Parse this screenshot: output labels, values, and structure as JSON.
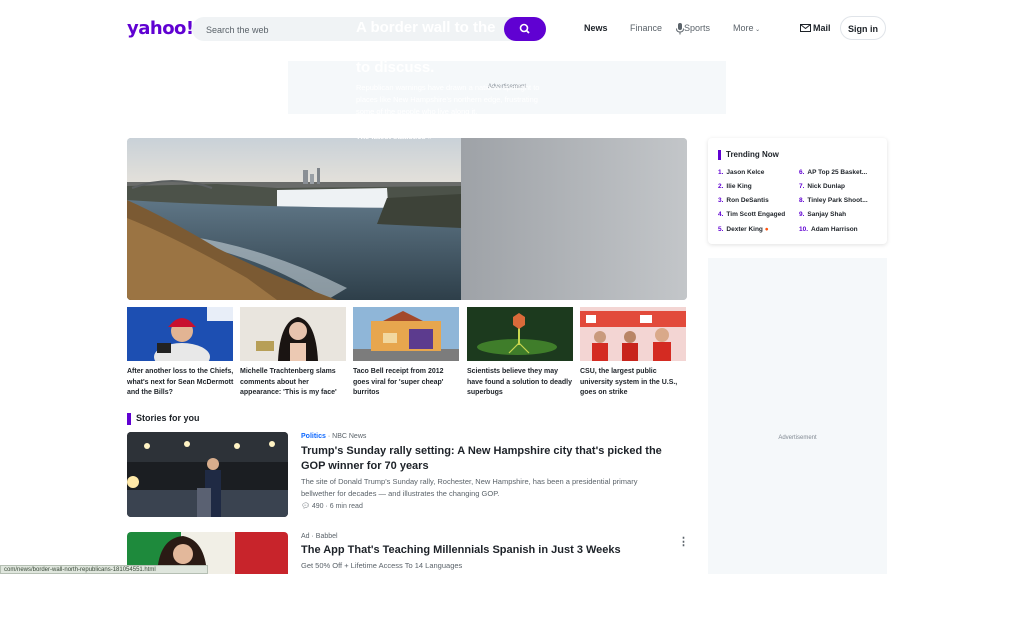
{
  "header": {
    "logo": "yahoo!",
    "search_placeholder": "Search the web",
    "nav": [
      "News",
      "Finance",
      "Sports",
      "More"
    ],
    "mail_label": "Mail",
    "signin_label": "Sign in"
  },
  "ads": {
    "top": "Advertisement",
    "right": "Advertisement"
  },
  "hero": {
    "title": "A border wall to the north? Republicans want to discuss.",
    "description": "Republican warnings have drawn a national spotlight to places like New Hampshire's northern edge, frustrating some of the people who live along it.",
    "link": "The latest statistics »"
  },
  "thumbs": [
    {
      "caption": "After another loss to the Chiefs, what's next for Sean McDermott and the Bills?"
    },
    {
      "caption": "Michelle Trachtenberg slams comments about her appearance: 'This is my face'"
    },
    {
      "caption": "Taco Bell receipt from 2012 goes viral for 'super cheap' burritos"
    },
    {
      "caption": "Scientists believe they may have found a solution to deadly superbugs"
    },
    {
      "caption": "CSU, the largest public university system in the U.S., goes on strike"
    }
  ],
  "stories_heading": "Stories for you",
  "stories": [
    {
      "category": "Politics",
      "source": "NBC News",
      "title": "Trump's Sunday rally setting: A New Hampshire city that's picked the GOP winner for 70 years",
      "description": "The site of Donald Trump's Sunday rally, Rochester, New Hampshire, has been a presidential primary bellwether for decades — and illustrates the changing GOP.",
      "comments": "490",
      "read_time": "6 min read"
    },
    {
      "category": "Ad",
      "source": "Babbel",
      "title": "The App That's Teaching Millennials Spanish in Just 3 Weeks",
      "description": "Get 50% Off + Lifetime Access To 14 Languages"
    }
  ],
  "trending": {
    "heading": "Trending Now",
    "items": [
      {
        "n": "1.",
        "label": "Jason Kelce"
      },
      {
        "n": "2.",
        "label": "Ilie King"
      },
      {
        "n": "3.",
        "label": "Ron DeSantis"
      },
      {
        "n": "4.",
        "label": "Tim Scott Engaged"
      },
      {
        "n": "5.",
        "label": "Dexter King"
      },
      {
        "n": "6.",
        "label": "AP Top 25 Basket..."
      },
      {
        "n": "7.",
        "label": "Nick Dunlap"
      },
      {
        "n": "8.",
        "label": "Tinley Park Shoot..."
      },
      {
        "n": "9.",
        "label": "Sanjay Shah"
      },
      {
        "n": "10.",
        "label": "Adam Harrison"
      }
    ]
  },
  "status_url": "com/news/border-wall-north-republicans-181054551.html"
}
